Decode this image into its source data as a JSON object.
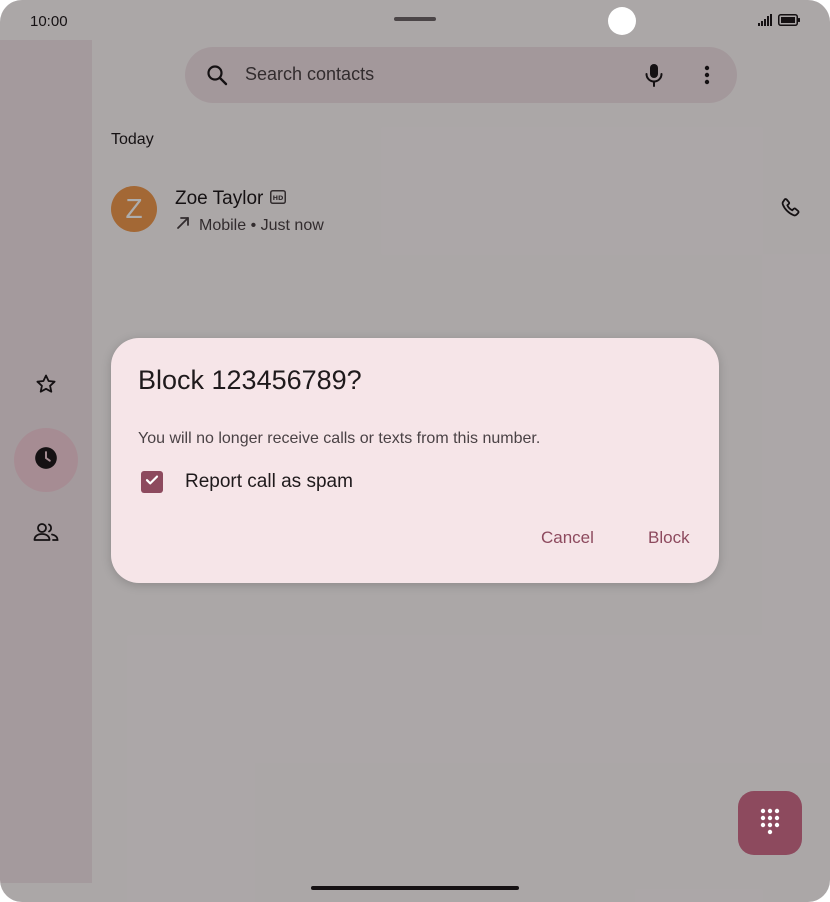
{
  "status_bar": {
    "time": "10:00"
  },
  "search": {
    "placeholder": "Search contacts"
  },
  "call_log": {
    "section_header": "Today",
    "entries": [
      {
        "avatar_letter": "Z",
        "name": "Zoe Taylor",
        "meta": "Mobile • Just now"
      }
    ]
  },
  "nav_rail": {
    "items": [
      "star-icon",
      "clock-icon",
      "people-icon"
    ],
    "active": "clock-icon"
  },
  "dialog": {
    "title": "Block 123456789?",
    "body": "You will no longer receive calls or texts from this number.",
    "checkbox_label": "Report call as spam",
    "checkbox_checked": true,
    "cancel_label": "Cancel",
    "block_label": "Block"
  },
  "colors": {
    "accent": "#8d4a5e",
    "avatar": "#f09a4f",
    "surface": "#f6e5e8"
  }
}
